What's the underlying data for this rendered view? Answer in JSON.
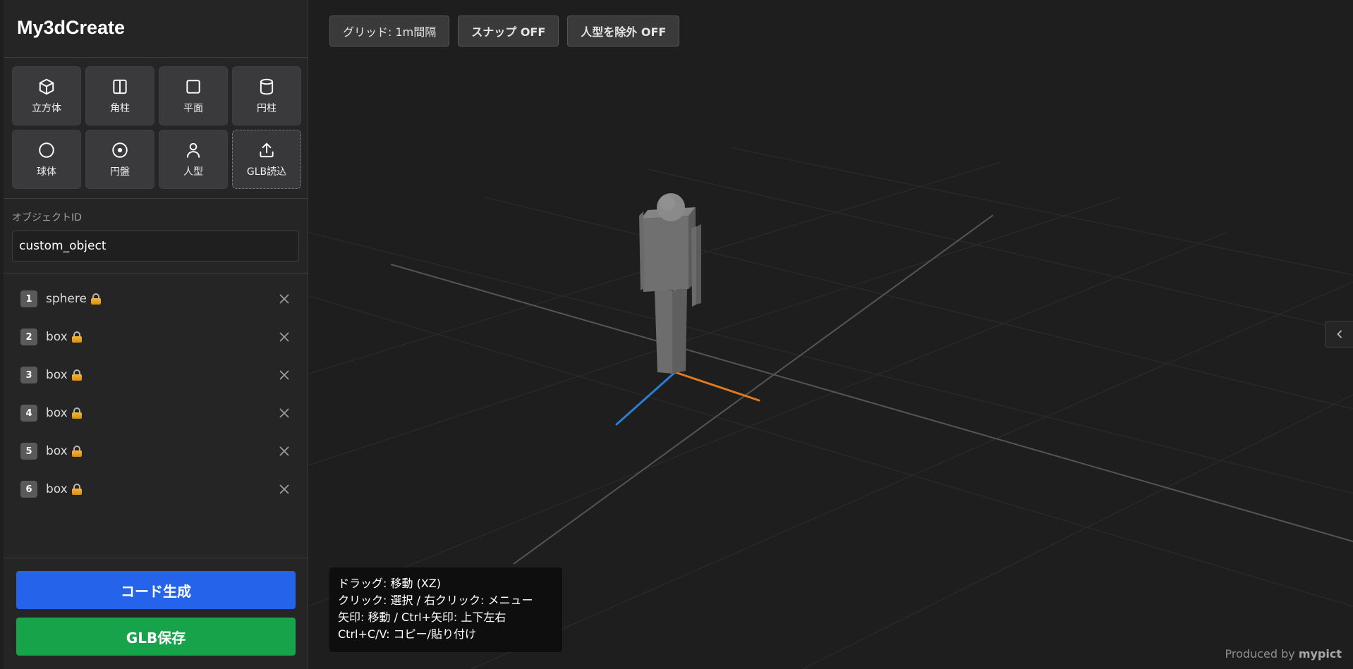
{
  "app": {
    "title": "My3dCreate"
  },
  "tools": [
    {
      "label": "立方体",
      "icon": "cube-icon"
    },
    {
      "label": "角柱",
      "icon": "prism-icon"
    },
    {
      "label": "平面",
      "icon": "plane-icon"
    },
    {
      "label": "円柱",
      "icon": "cylinder-icon"
    },
    {
      "label": "球体",
      "icon": "sphere-icon"
    },
    {
      "label": "円盤",
      "icon": "disc-icon"
    },
    {
      "label": "人型",
      "icon": "person-icon"
    },
    {
      "label": "GLB読込",
      "icon": "upload-icon"
    }
  ],
  "object_id": {
    "label": "オブジェクトID",
    "value": "custom_object"
  },
  "objects": [
    {
      "num": "1",
      "name": "sphere"
    },
    {
      "num": "2",
      "name": "box"
    },
    {
      "num": "3",
      "name": "box"
    },
    {
      "num": "4",
      "name": "box"
    },
    {
      "num": "5",
      "name": "box"
    },
    {
      "num": "6",
      "name": "box"
    }
  ],
  "actions": {
    "generate": "コード生成",
    "save_glb": "GLB保存"
  },
  "toolbar": {
    "grid": "グリッド: 1m間隔",
    "snap": "スナップ OFF",
    "exclude_person": "人型を除外 OFF"
  },
  "hints": [
    "ドラッグ: 移動 (XZ)",
    "クリック: 選択 / 右クリック: メニュー",
    "矢印: 移動 / Ctrl+矢印: 上下左右",
    "Ctrl+C/V: コピー/貼り付け"
  ],
  "credit": {
    "prefix": "Produced by",
    "brand": "mypict"
  },
  "colors": {
    "accent_blue": "#2563eb",
    "accent_green": "#16a34a",
    "axis_x": "#e07a1f",
    "axis_y": "#7ed321",
    "axis_z": "#2a7fd4"
  }
}
